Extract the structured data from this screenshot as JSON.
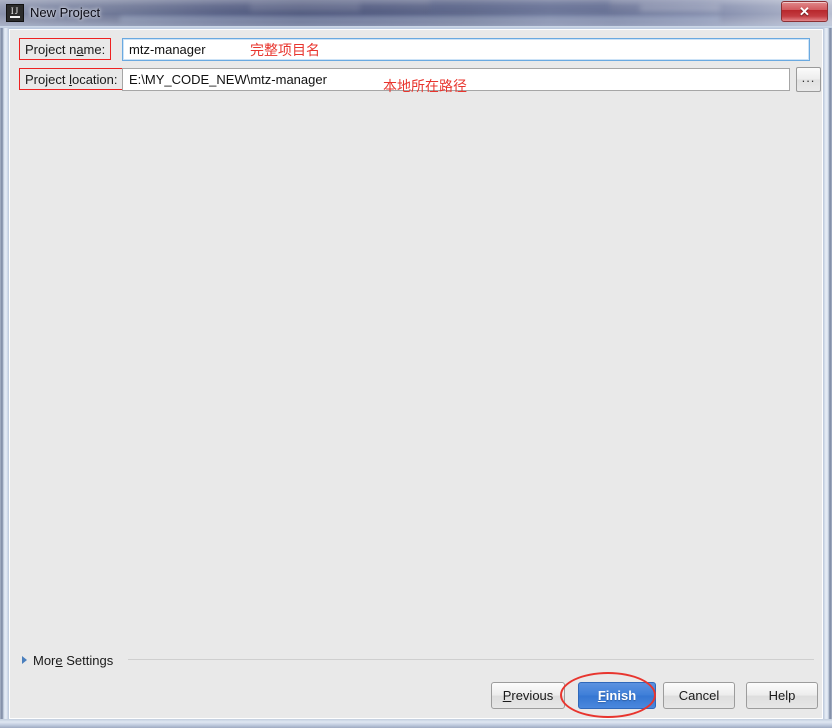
{
  "window": {
    "title": "New Project",
    "app_icon": "intellij-idea-icon",
    "close_label": "✕"
  },
  "form": {
    "name_row": {
      "label_prefix": "Project n",
      "label_mnemonic": "a",
      "label_suffix": "me:",
      "value": "mtz-manager"
    },
    "location_row": {
      "label_prefix": "Project ",
      "label_mnemonic": "l",
      "label_suffix": "ocation:",
      "value": "E:\\MY_CODE_NEW\\mtz-manager",
      "browse_label": "..."
    }
  },
  "annotations": {
    "project_name_note": "完整项目名",
    "project_location_note": "本地所在路径",
    "finish_highlight": "finish-button-circle"
  },
  "more_settings": {
    "label_prefix": "Mor",
    "label_mnemonic": "e",
    "label_suffix": " Settings",
    "expanded": false
  },
  "buttons": {
    "previous": {
      "prefix": "",
      "mnemonic": "P",
      "suffix": "revious"
    },
    "finish": {
      "prefix": "",
      "mnemonic": "F",
      "suffix": "inish"
    },
    "cancel": {
      "prefix": "Cancel",
      "mnemonic": "",
      "suffix": ""
    },
    "help": {
      "prefix": "Help",
      "mnemonic": "",
      "suffix": ""
    }
  },
  "colors": {
    "annotation_red": "#e8352e",
    "finish_blue": "#3f7fd8",
    "dialog_bg": "#e9e9e9",
    "focus_border": "#6aa9e0"
  }
}
